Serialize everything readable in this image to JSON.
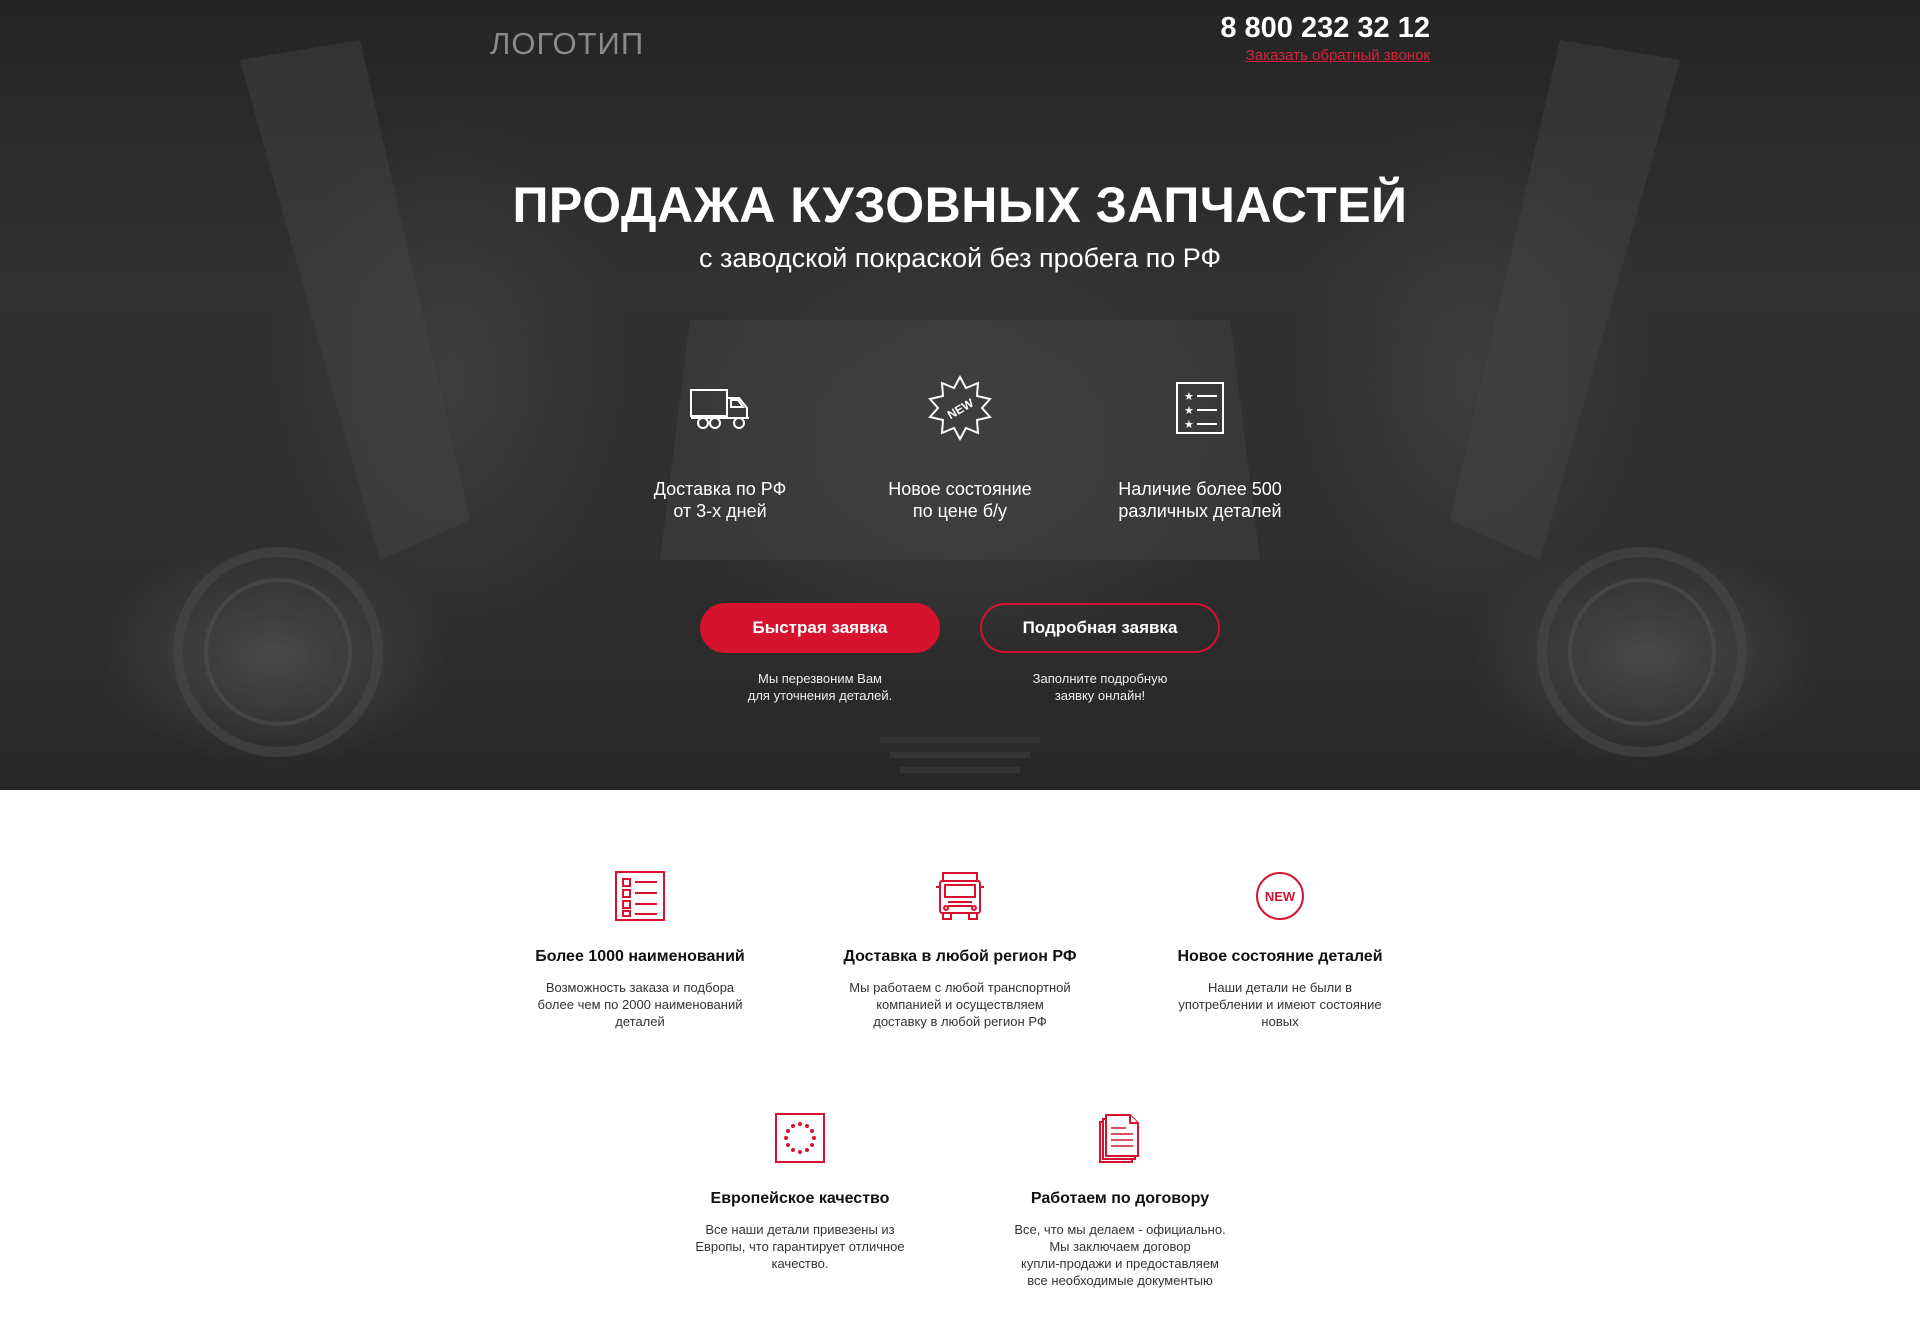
{
  "header": {
    "logo": "ЛОГОТИП",
    "phone": "8 800 232 32 12",
    "callback_link": "Заказать обратный звонок"
  },
  "hero": {
    "title": "ПРОДАЖА КУЗОВНЫХ ЗАПЧАСТЕЙ",
    "subtitle": "с заводской покраской без пробега по РФ",
    "features": [
      {
        "icon": "delivery-truck-icon",
        "line1": "Доставка по РФ",
        "line2": "от 3-х дней"
      },
      {
        "icon": "new-badge-icon",
        "badge": "NEW",
        "line1": "Новое состояние",
        "line2": "по цене б/у"
      },
      {
        "icon": "star-list-icon",
        "line1": "Наличие более 500",
        "line2": "различных деталей"
      }
    ],
    "buttons": {
      "quick": {
        "label": "Быстрая заявка",
        "note1": "Мы перезвоним Вам",
        "note2": "для уточнения деталей."
      },
      "detailed": {
        "label": "Подробная заявка",
        "note1": "Заполните подробную",
        "note2": "заявку онлайн!"
      }
    }
  },
  "benefits": [
    {
      "icon": "catalog-list-icon",
      "title": "Более 1000 наименований",
      "lines": [
        "Возможность заказа и подбора",
        "более чем по 2000 наименований",
        "деталей"
      ]
    },
    {
      "icon": "truck-front-icon",
      "title": "Доставка в любой регион РФ",
      "lines": [
        "Мы работаем с любой транспортной",
        "компанией и осуществляем",
        "доставку в любой регион РФ"
      ]
    },
    {
      "icon": "new-circle-icon",
      "badge": "NEW",
      "title": "Новое состояние деталей",
      "lines": [
        "Наши детали не были в",
        "употреблении и имеют состояние",
        "новых"
      ]
    },
    {
      "icon": "eu-stars-icon",
      "title": "Европейское качество",
      "lines": [
        "Все наши детали привезены из",
        "Европы, что гарантирует отличное",
        "качество."
      ]
    },
    {
      "icon": "contract-documents-icon",
      "title": "Работаем по договору",
      "lines": [
        "Все, что мы делаем - официально.",
        "Мы заключаем договор",
        "купли-продажи и предоставляем",
        "все необходимые документыю"
      ]
    }
  ],
  "colors": {
    "accent": "#d6132f",
    "hero_bg": "#333333",
    "text_dark": "#111111"
  }
}
